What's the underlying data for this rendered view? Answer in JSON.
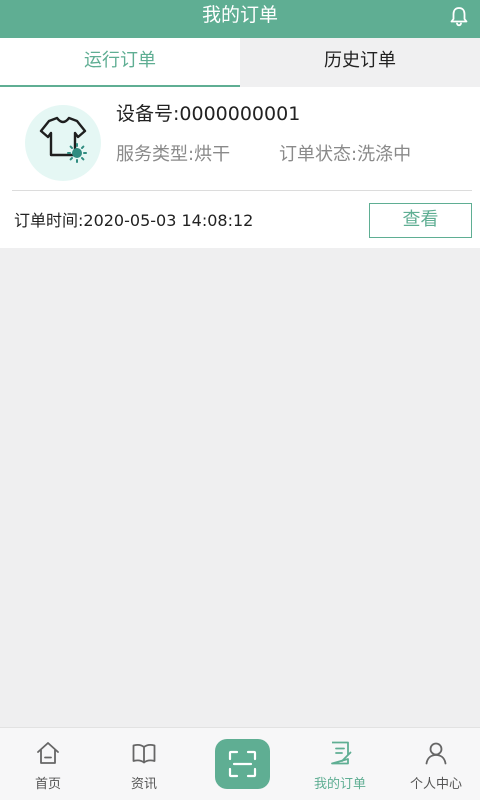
{
  "header": {
    "title": "我的订单"
  },
  "tabs": [
    {
      "label": "运行订单",
      "active": true
    },
    {
      "label": "历史订单",
      "active": false
    }
  ],
  "order": {
    "device_no": "设备号:0000000001",
    "service_type": "服务类型:烘干",
    "order_status": "订单状态:洗涤中",
    "order_time": "订单时间:2020-05-03 14:08:12",
    "view_label": "查看"
  },
  "nav": {
    "items": [
      {
        "label": "首页",
        "icon": "home-icon"
      },
      {
        "label": "资讯",
        "icon": "book-icon"
      },
      {
        "label": "",
        "icon": "scan-icon"
      },
      {
        "label": "我的订单",
        "icon": "order-icon",
        "active": true
      },
      {
        "label": "个人中心",
        "icon": "person-icon"
      }
    ]
  },
  "colors": {
    "accent": "#5fae93",
    "background": "#efeff0"
  }
}
